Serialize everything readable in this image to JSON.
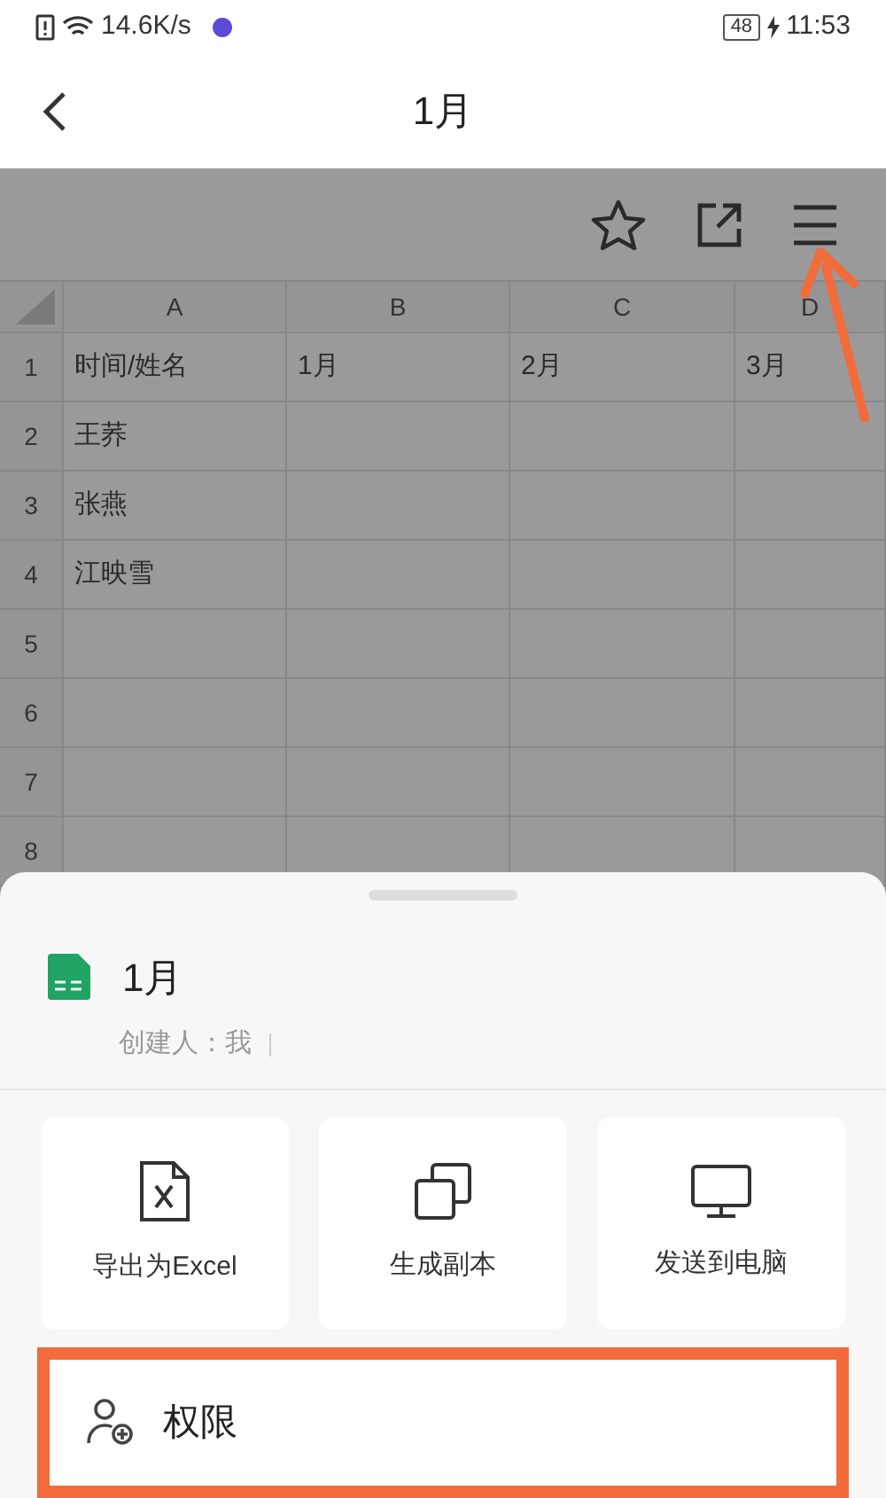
{
  "status_bar": {
    "speed": "14.6K/s",
    "battery": "48",
    "time": "11:53"
  },
  "nav": {
    "title": "1月"
  },
  "sheet": {
    "columns": [
      "A",
      "B",
      "C",
      "D"
    ],
    "rows": [
      {
        "number": "1",
        "cells": [
          "时间/姓名",
          "1月",
          "2月",
          "3月"
        ]
      },
      {
        "number": "2",
        "cells": [
          "王荞",
          "",
          "",
          ""
        ]
      },
      {
        "number": "3",
        "cells": [
          "张燕",
          "",
          "",
          ""
        ]
      },
      {
        "number": "4",
        "cells": [
          "江映雪",
          "",
          "",
          ""
        ]
      },
      {
        "number": "5",
        "cells": [
          "",
          "",
          "",
          ""
        ]
      },
      {
        "number": "6",
        "cells": [
          "",
          "",
          "",
          ""
        ]
      },
      {
        "number": "7",
        "cells": [
          "",
          "",
          "",
          ""
        ]
      },
      {
        "number": "8",
        "cells": [
          "",
          "",
          "",
          ""
        ]
      }
    ]
  },
  "bottom_sheet": {
    "title": "1月",
    "creator": "创建人：我",
    "actions": [
      {
        "kind": "excel",
        "label": "导出为Excel"
      },
      {
        "kind": "copy",
        "label": "生成副本"
      },
      {
        "kind": "computer",
        "label": "发送到电脑"
      }
    ],
    "permission": {
      "label": "权限"
    }
  }
}
